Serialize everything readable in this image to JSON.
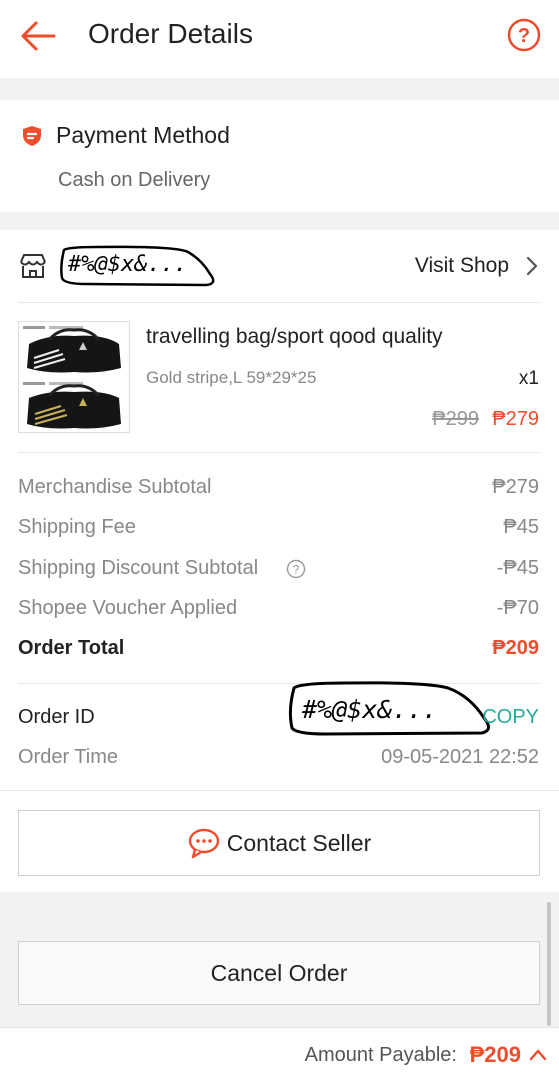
{
  "header": {
    "title": "Order Details"
  },
  "payment": {
    "title": "Payment Method",
    "value": "Cash on Delivery"
  },
  "shop": {
    "name": "#%@$x&...",
    "visit_label": "Visit Shop"
  },
  "product": {
    "name": "travelling bag/sport qood quality",
    "variation": "Gold stripe,L 59*29*25",
    "quantity": "x1",
    "original_price": "₱299",
    "price": "₱279"
  },
  "summary": [
    {
      "label": "Merchandise Subtotal",
      "value": "₱279"
    },
    {
      "label": "Shipping Fee",
      "value": "₱45"
    },
    {
      "label": "Shipping Discount Subtotal",
      "value": "-₱45"
    },
    {
      "label": "Shopee Voucher Applied",
      "value": "-₱70"
    },
    {
      "label": "Order Total",
      "value": "₱209"
    }
  ],
  "order": {
    "id_label": "Order ID",
    "id_value": "#%@$x&...",
    "copy_label": "COPY",
    "time_label": "Order Time",
    "time_value": "09-05-2021 22:52"
  },
  "buttons": {
    "contact": "Contact Seller",
    "cancel": "Cancel Order"
  },
  "footer": {
    "label": "Amount Payable:",
    "value": "₱209"
  },
  "colors": {
    "accent": "#ee4d2d",
    "copy": "#26aa99"
  }
}
